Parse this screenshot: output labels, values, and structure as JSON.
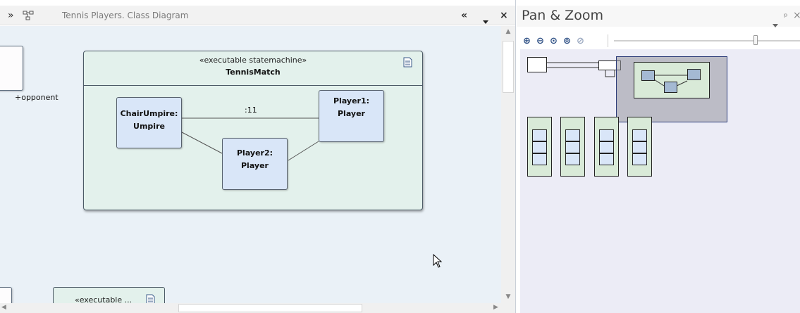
{
  "diagram_tab": {
    "title": "Tennis Players.  Class Diagram",
    "icons": [
      "double-chevron-right-icon",
      "diagram-icon",
      "double-chevron-left-icon",
      "dropdown-icon",
      "close-icon"
    ]
  },
  "diagram": {
    "statemachine": {
      "stereotype": "«executable statemachine»",
      "name": "TennisMatch"
    },
    "parts": [
      {
        "name": "ChairUmpire:\nUmpire"
      },
      {
        "name": "Player1: Player"
      },
      {
        "name": "Player2: Player"
      }
    ],
    "connector_label": ":11",
    "role_label": "+opponent",
    "bottom_element": {
      "stereotype": "«executable ..."
    }
  },
  "pan_zoom": {
    "title": "Pan & Zoom",
    "zoom_level": 0.75,
    "toolbar_icons": [
      "zoom-in-icon",
      "zoom-out-icon",
      "zoom-fit-icon",
      "zoom-actual-icon",
      "zoom-disabled-icon"
    ]
  },
  "colors": {
    "canvas": "#eaf1f7",
    "statemachine_fill": "#e3f1ec",
    "part_fill": "#d9e6f8",
    "viewport_border": "#2c3b78"
  }
}
